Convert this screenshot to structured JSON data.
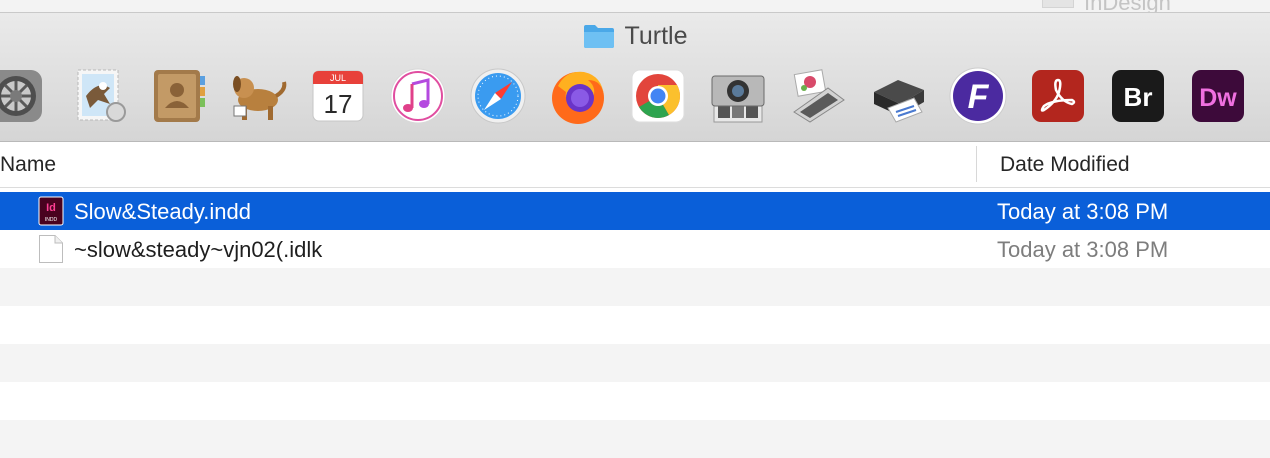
{
  "background_window": {
    "title": "InDesign"
  },
  "window": {
    "title": "Turtle"
  },
  "dock_apps": [
    {
      "name": "System Preferences",
      "icon": "gear-icon"
    },
    {
      "name": "Mail",
      "icon": "stamp-eagle-icon"
    },
    {
      "name": "Contacts",
      "icon": "address-book-icon"
    },
    {
      "name": "Dog app",
      "icon": "dog-icon"
    },
    {
      "name": "Calendar",
      "icon": "calendar-icon",
      "month": "JUL",
      "day": "17"
    },
    {
      "name": "iTunes",
      "icon": "music-note-icon"
    },
    {
      "name": "Safari",
      "icon": "compass-icon"
    },
    {
      "name": "Firefox",
      "icon": "firefox-icon"
    },
    {
      "name": "Chrome",
      "icon": "chrome-icon"
    },
    {
      "name": "Image Capture",
      "icon": "camera-icon"
    },
    {
      "name": "Scanner",
      "icon": "scanner-icon"
    },
    {
      "name": "Printer",
      "icon": "printer-icon"
    },
    {
      "name": "Fusion",
      "icon": "f-logo-icon",
      "letter": "F"
    },
    {
      "name": "Acrobat",
      "icon": "acrobat-icon"
    },
    {
      "name": "Bridge",
      "icon": "bridge-icon",
      "letters": "Br"
    },
    {
      "name": "Dreamweaver",
      "icon": "dreamweaver-icon",
      "letters": "Dw"
    }
  ],
  "columns": {
    "name": "Name",
    "date_modified": "Date Modified"
  },
  "files": [
    {
      "name": "Slow&Steady.indd",
      "date": "Today at 3:08 PM",
      "selected": true,
      "icon": "indesign-file-icon",
      "badge_top": "Id",
      "badge_bottom": "INDD"
    },
    {
      "name": "~slow&steady~vjn02(.idlk",
      "date": "Today at 3:08 PM",
      "selected": false,
      "icon": "blank-document-icon"
    }
  ],
  "colors": {
    "selection": "#0a5fd9",
    "alt_row": "#f4f4f4",
    "folder": "#5bb6ef"
  }
}
